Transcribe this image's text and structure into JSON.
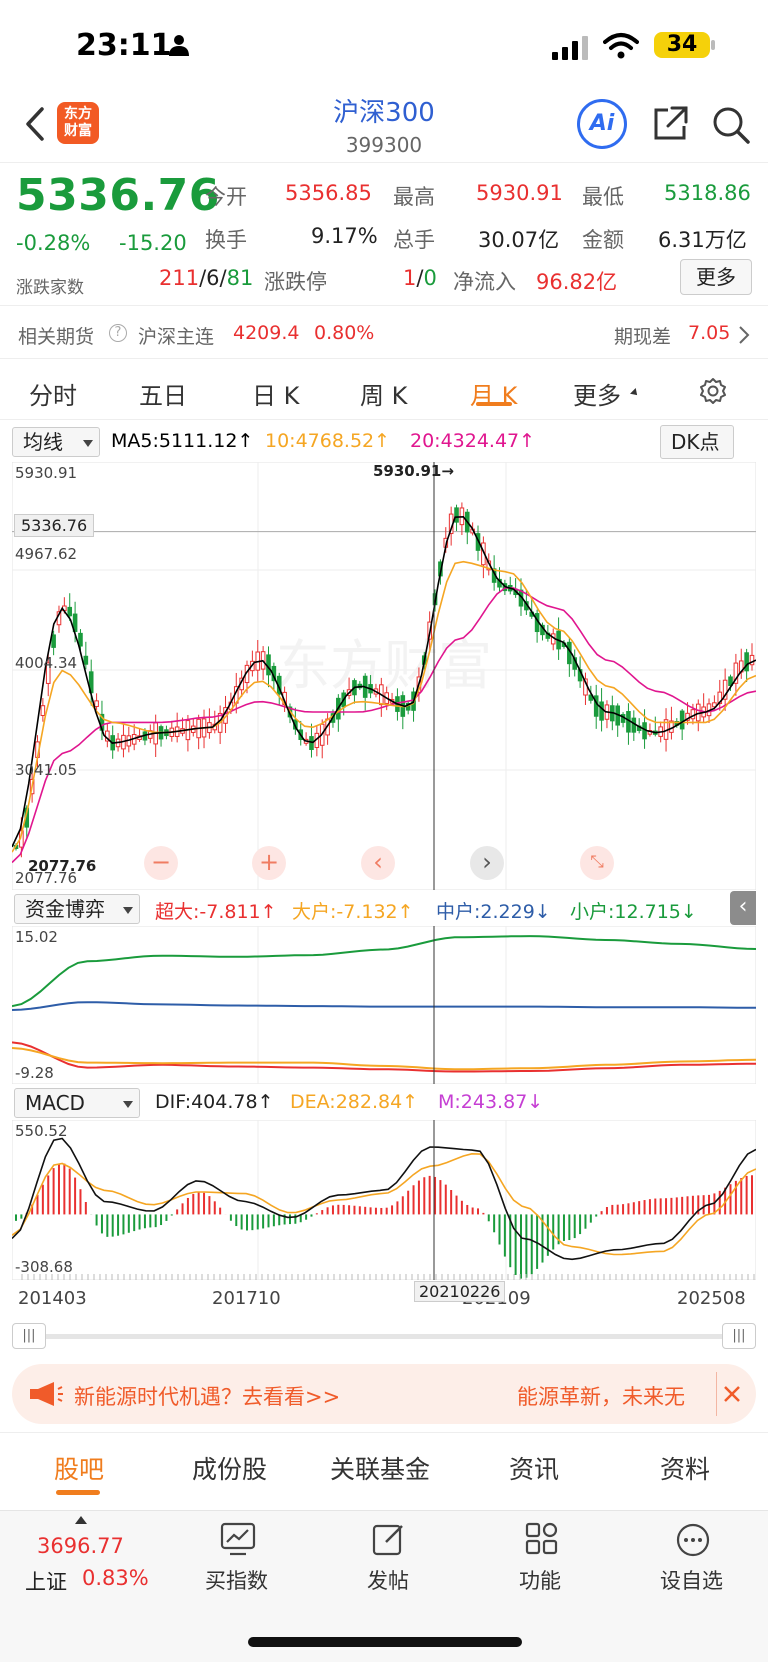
{
  "status_bar": {
    "time": "23:11",
    "battery": "34"
  },
  "header": {
    "logo_text": "东方\n财富",
    "title": "沪深300",
    "code": "399300",
    "ai_label": "Ai"
  },
  "quote": {
    "price": "5336.76",
    "change_pct": "-0.28%",
    "change": "-15.20",
    "open_label": "今开",
    "open": "5356.85",
    "high_label": "最高",
    "high": "5930.91",
    "low_label": "最低",
    "low": "5318.86",
    "turnover_label": "换手",
    "turnover": "9.17%",
    "volume_label": "总手",
    "volume": "30.07亿",
    "amount_label": "金额",
    "amount": "6.31万亿",
    "breadth_label": "涨跌家数",
    "breadth_up": "211",
    "breadth_flat": "6",
    "breadth_down": "81",
    "sep": "/",
    "limit_label": "涨跌停",
    "limit_up": "1",
    "limit_down": "0",
    "netflow_label": "净流入",
    "netflow": "96.82亿",
    "more_label": "更多"
  },
  "futures": {
    "label": "相关期货",
    "contract": "沪深主连",
    "price": "4209.4",
    "pct": "0.80%",
    "basis_label": "期现差",
    "basis": "7.05"
  },
  "tabs": [
    {
      "label": "分时"
    },
    {
      "label": "五日"
    },
    {
      "label": "日 K"
    },
    {
      "label": "周 K"
    },
    {
      "label": "月 K"
    },
    {
      "label": "更多"
    }
  ],
  "active_tab": "月 K",
  "ma_legend": {
    "selector": "均线",
    "ma5": "MA5:5111.12↑",
    "ma10": "10:4768.52↑",
    "ma20": "20:4324.47↑",
    "dk": "DK点"
  },
  "kline_axis": {
    "top": "5930.91",
    "last": "5336.76",
    "y2": "4967.62",
    "y3": "4004.34",
    "y4": "3041.05",
    "bottom": "2077.76",
    "peak_marker": "5930.91→",
    "trough_marker": "2077.76"
  },
  "fund_legend": {
    "selector": "资金博弈",
    "super": "超大:-7.811↑",
    "large": "大户:-7.132↑",
    "mid": "中户:2.229↓",
    "small": "小户:12.715↓",
    "ymax": "15.02",
    "ymin": "-9.28"
  },
  "macd_legend": {
    "selector": "MACD",
    "dif": "DIF:404.78↑",
    "dea": "DEA:282.84↑",
    "m": "M:243.87↓",
    "ymax": "550.52",
    "ymin": "-308.68"
  },
  "x_axis": {
    "d1": "201403",
    "d2": "201710",
    "crosshair": "20210226",
    "d3": "202109",
    "d4": "202508"
  },
  "ad": {
    "left": "新能源时代机遇？去看看>>",
    "right": "能源革新，未来无"
  },
  "section_tabs": [
    {
      "label": "股吧"
    },
    {
      "label": "成份股"
    },
    {
      "label": "关联基金"
    },
    {
      "label": "资讯"
    },
    {
      "label": "资料"
    }
  ],
  "bottom_nav": {
    "index_price": "3696.77",
    "index_name": "上证",
    "index_pct": "0.83%",
    "buy_index": "买指数",
    "post": "发帖",
    "function": "功能",
    "watch": "设自选"
  },
  "colors": {
    "up": "#e93030",
    "down": "#1a9b3c",
    "accent": "#f07d1e",
    "ma5": "#000000",
    "ma10": "#f5a623",
    "ma20": "#e0168f"
  },
  "chart_data": [
    {
      "type": "line",
      "title": "月K",
      "x": [
        "201403",
        "201710",
        "202109",
        "202508"
      ],
      "ylim": [
        2077.76,
        5930.91
      ],
      "series": [
        {
          "name": "MA5",
          "values": [
            2300,
            4600,
            3300,
            3400,
            3450,
            4100,
            3300,
            3850,
            3650,
            5500,
            4800,
            4300,
            3600,
            3400,
            3600,
            4100
          ]
        },
        {
          "name": "10",
          "values": [
            2250,
            4000,
            3500,
            3400,
            3450,
            3900,
            3450,
            3700,
            3650,
            5050,
            4950,
            4400,
            3850,
            3500,
            3500,
            3950
          ]
        },
        {
          "name": "20",
          "values": [
            2150,
            3200,
            3500,
            3500,
            3550,
            3700,
            3600,
            3600,
            3700,
            4300,
            4800,
            4600,
            4100,
            3800,
            3600,
            3800
          ]
        }
      ]
    },
    {
      "type": "line",
      "title": "资金博弈",
      "ylim": [
        -9.28,
        15.02
      ],
      "series": [
        {
          "name": "超大",
          "values": [
            -4,
            -8.5,
            -8,
            -8.3,
            -8.5,
            -8.8,
            -9.2,
            -9.1,
            -8.6,
            -8.0,
            -7.8
          ]
        },
        {
          "name": "大户",
          "values": [
            -5,
            -7.6,
            -7.7,
            -7.6,
            -7.6,
            -8.2,
            -8.8,
            -8.6,
            -8.0,
            -7.4,
            -7.1
          ]
        },
        {
          "name": "中户",
          "values": [
            1.8,
            3.2,
            2.8,
            2.6,
            2.5,
            2.4,
            2.4,
            2.4,
            2.3,
            2.3,
            2.2
          ]
        },
        {
          "name": "小户",
          "values": [
            2.5,
            10.5,
            11.5,
            11.3,
            11.6,
            12.6,
            14.8,
            15.0,
            14.3,
            13.6,
            12.7
          ]
        }
      ]
    },
    {
      "type": "line",
      "title": "MACD",
      "ylim": [
        -308.68,
        550.52
      ],
      "series": [
        {
          "name": "DIF",
          "values": [
            -150,
            480,
            80,
            20,
            210,
            80,
            -20,
            120,
            150,
            420,
            400,
            -150,
            -280,
            -220,
            -180,
            60,
            404.78
          ]
        },
        {
          "name": "DEA",
          "values": [
            -130,
            320,
            150,
            60,
            140,
            130,
            10,
            90,
            130,
            300,
            380,
            50,
            -200,
            -250,
            -230,
            0,
            282.84
          ]
        }
      ]
    }
  ]
}
